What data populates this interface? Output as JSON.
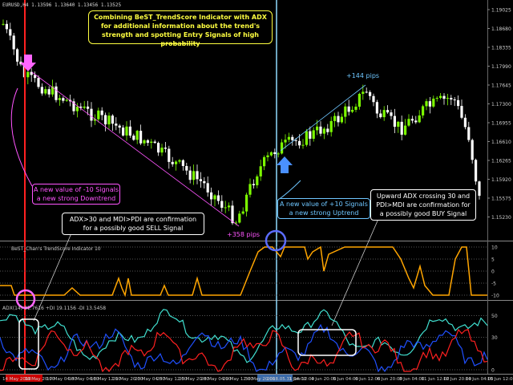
{
  "chart_data": [
    {
      "type": "candlestick",
      "symbol_header": "EURUSD,H4  1.13596  1.13640  1.13456  1.13525",
      "y_ticks": [
        "1.19025",
        "1.18680",
        "1.18335",
        "1.17990",
        "1.17645",
        "1.17300",
        "1.16955",
        "1.16610",
        "1.16265",
        "1.15920",
        "1.15575",
        "1.15230"
      ],
      "price_labels": [
        {
          "text": "+144 pips",
          "color": "#6ec6ff"
        },
        {
          "text": "+358 pips",
          "color": "#ff55ff"
        }
      ]
    },
    {
      "type": "line",
      "title": "BeST_Chan's TrendScore Indicator 10",
      "y_ticks": [
        "10",
        "5",
        "0",
        "-5",
        "-10"
      ],
      "series": [
        {
          "color": "#ffa500"
        }
      ]
    },
    {
      "type": "line",
      "title": "ADX(14) 31.7616 +DI 19.1156 -DI 13.5458",
      "y_ticks": [
        "50",
        "30",
        "0"
      ],
      "series": [
        {
          "color": "#40e0d0"
        },
        {
          "color": "#2050ff"
        },
        {
          "color": "#ff2020"
        }
      ]
    }
  ],
  "time_axis": [
    "14 May 2018",
    "16 May 20:00",
    "17 May 04:00",
    "18 May 04:00",
    "18 May 12:00",
    "21 May 20:00",
    "23 May 04:00",
    "25 May 12:00",
    "25 May 20:00",
    "28 May 04:00",
    "29 May 12:00",
    "30 May 20:00",
    "2018.05.31 04:00",
    "1 Jun 12:00",
    "4 Jun 20:00",
    "5 Jun 04:00",
    "6 Jun 12:00",
    "6 Jun 20:00",
    "8 Jun 04:00",
    "11 Jun 12:00",
    "12 Jun 20:00",
    "14 Jun 04:00",
    "15 Jun 12:00"
  ],
  "notes": {
    "title": "Combining BeST_TrendScore Indicator with ADX\nfor additional information about the trend's\nstrength and spotting Entry Signals of high probability",
    "down_signal": "A new value of -10 Signals\na new strong Downtrend",
    "up_signal": "A new value of +10 Signals\na new strong Uptrend",
    "sell_confirm": "ADX>30 and MDI>PDI are confirmation\nfor a possibly good SELL Signal",
    "buy_confirm": "Upward ADX crossing 30 and\nPDI>MDI are confirmation for\na possibly good BUY Signal"
  },
  "colors": {
    "bull_candle": "#7cfc00",
    "bear_candle": "#ffffff",
    "grid": "#2a3a2a",
    "axis_text": "#cccccc",
    "note_yellow": "#ffff40",
    "note_magenta": "#ff55ff",
    "note_cyan": "#6ec6ff",
    "note_white": "#ffffff",
    "red_line": "#ff2020",
    "blue_line": "#8fdcff"
  }
}
